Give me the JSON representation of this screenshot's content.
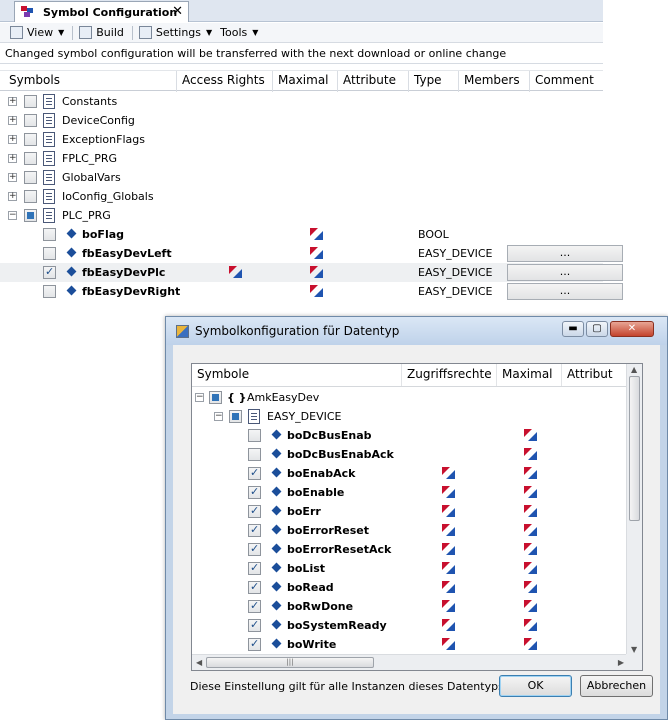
{
  "editor": {
    "tab_title": "Symbol Configuration",
    "tab_close": "✕",
    "toolbar": {
      "view_label": "View",
      "build_label": "Build",
      "settings_label": "Settings",
      "tools_label": "Tools"
    },
    "info_text": "Changed symbol configuration will be transferred with the next download or online change",
    "columns": [
      "Symbols",
      "Access Rights",
      "Maximal",
      "Attribute",
      "Type",
      "Members",
      "Comment"
    ],
    "tree": [
      {
        "label": "Constants",
        "expander": "+"
      },
      {
        "label": "DeviceConfig",
        "expander": "+"
      },
      {
        "label": "ExceptionFlags",
        "expander": "+"
      },
      {
        "label": "FPLC_PRG",
        "expander": "+"
      },
      {
        "label": "GlobalVars",
        "expander": "+"
      },
      {
        "label": "IoConfig_Globals",
        "expander": "+"
      },
      {
        "label": "PLC_PRG",
        "expander": "−"
      }
    ],
    "vars": [
      {
        "label": "boFlag",
        "type": "BOOL",
        "members": ""
      },
      {
        "label": "fbEasyDevLeft",
        "type": "EASY_DEVICE",
        "members": "..."
      },
      {
        "label": "fbEasyDevPlc",
        "type": "EASY_DEVICE",
        "members": "..."
      },
      {
        "label": "fbEasyDevRight",
        "type": "EASY_DEVICE",
        "members": "..."
      }
    ]
  },
  "dialog": {
    "title": "Symbolkonfiguration für Datentyp",
    "columns": [
      "Symbole",
      "Zugriffsrechte",
      "Maximal",
      "Attribut"
    ],
    "root_label": "AmkEasyDev",
    "root_icon": "{ }",
    "type_label": "EASY_DEVICE",
    "members": [
      {
        "label": "boDcBusEnab",
        "checked": false,
        "access": false
      },
      {
        "label": "boDcBusEnabAck",
        "checked": false,
        "access": false
      },
      {
        "label": "boEnabAck",
        "checked": true,
        "access": true
      },
      {
        "label": "boEnable",
        "checked": true,
        "access": true
      },
      {
        "label": "boErr",
        "checked": true,
        "access": true
      },
      {
        "label": "boErrorReset",
        "checked": true,
        "access": true
      },
      {
        "label": "boErrorResetAck",
        "checked": true,
        "access": true
      },
      {
        "label": "boList",
        "checked": true,
        "access": true
      },
      {
        "label": "boRead",
        "checked": true,
        "access": true
      },
      {
        "label": "boRwDone",
        "checked": true,
        "access": true
      },
      {
        "label": "boSystemReady",
        "checked": true,
        "access": true
      },
      {
        "label": "boWrite",
        "checked": true,
        "access": true
      }
    ],
    "footer_text": "Diese Einstellung gilt für alle Instanzen dieses Datentyps.",
    "ok_label": "OK",
    "cancel_label": "Abbrechen"
  }
}
